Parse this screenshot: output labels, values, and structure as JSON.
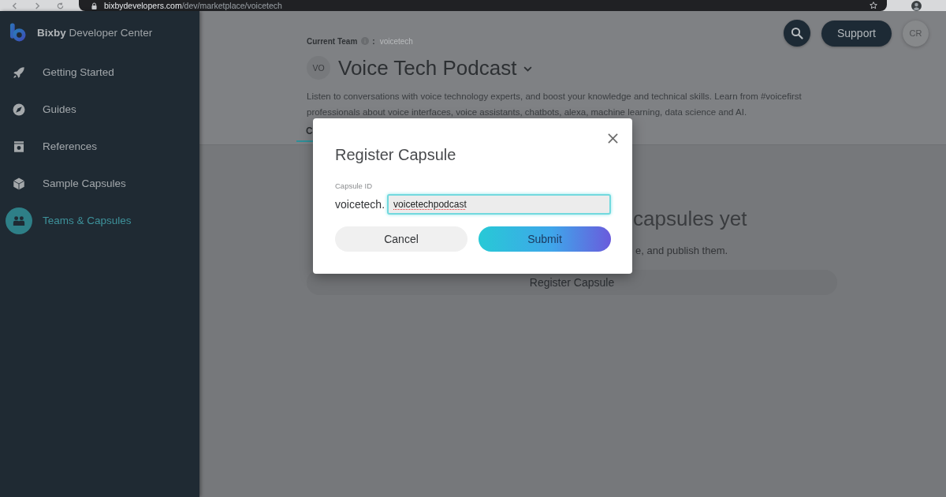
{
  "browser": {
    "url_host": "bixbydevelopers.com",
    "url_path": "/dev/marketplace/voicetech"
  },
  "sidebar": {
    "brand": "**Bixby** Developer Center",
    "items": [
      {
        "label": "Getting Started",
        "selected": false
      },
      {
        "label": "Guides",
        "selected": false
      },
      {
        "label": "References",
        "selected": false
      },
      {
        "label": "Sample Capsules",
        "selected": false
      },
      {
        "label": "Teams & Capsules",
        "selected": true
      }
    ]
  },
  "header": {
    "current_team_label": "Current Team",
    "separator": ":",
    "current_team": "voicetech",
    "team_initials": "VO",
    "team_name": "Voice Tech Podcast",
    "description": "Listen to conversations with voice technology experts, and boost your knowledge and technical skills. Learn from #voicefirst professionals about voice interfaces, voice assistants, chatbots, alexa, machine learning, data science and AI.",
    "tabs": [
      {
        "label": "C",
        "selected": true
      }
    ]
  },
  "top_actions": {
    "support": "Support",
    "user_initials": "CR"
  },
  "empty_state": {
    "title": "capsules yet",
    "text": "e, and publish them.",
    "button": "Register Capsule"
  },
  "dialog": {
    "title": "Register Capsule",
    "field_label": "Capsule ID",
    "prefix": "voicetech.",
    "value": "voicetechpodcast",
    "focused": true,
    "misspelled": true,
    "buttons": [
      {
        "label": "Cancel",
        "kind": "secondary"
      },
      {
        "label": "Submit",
        "kind": "primary"
      }
    ]
  }
}
